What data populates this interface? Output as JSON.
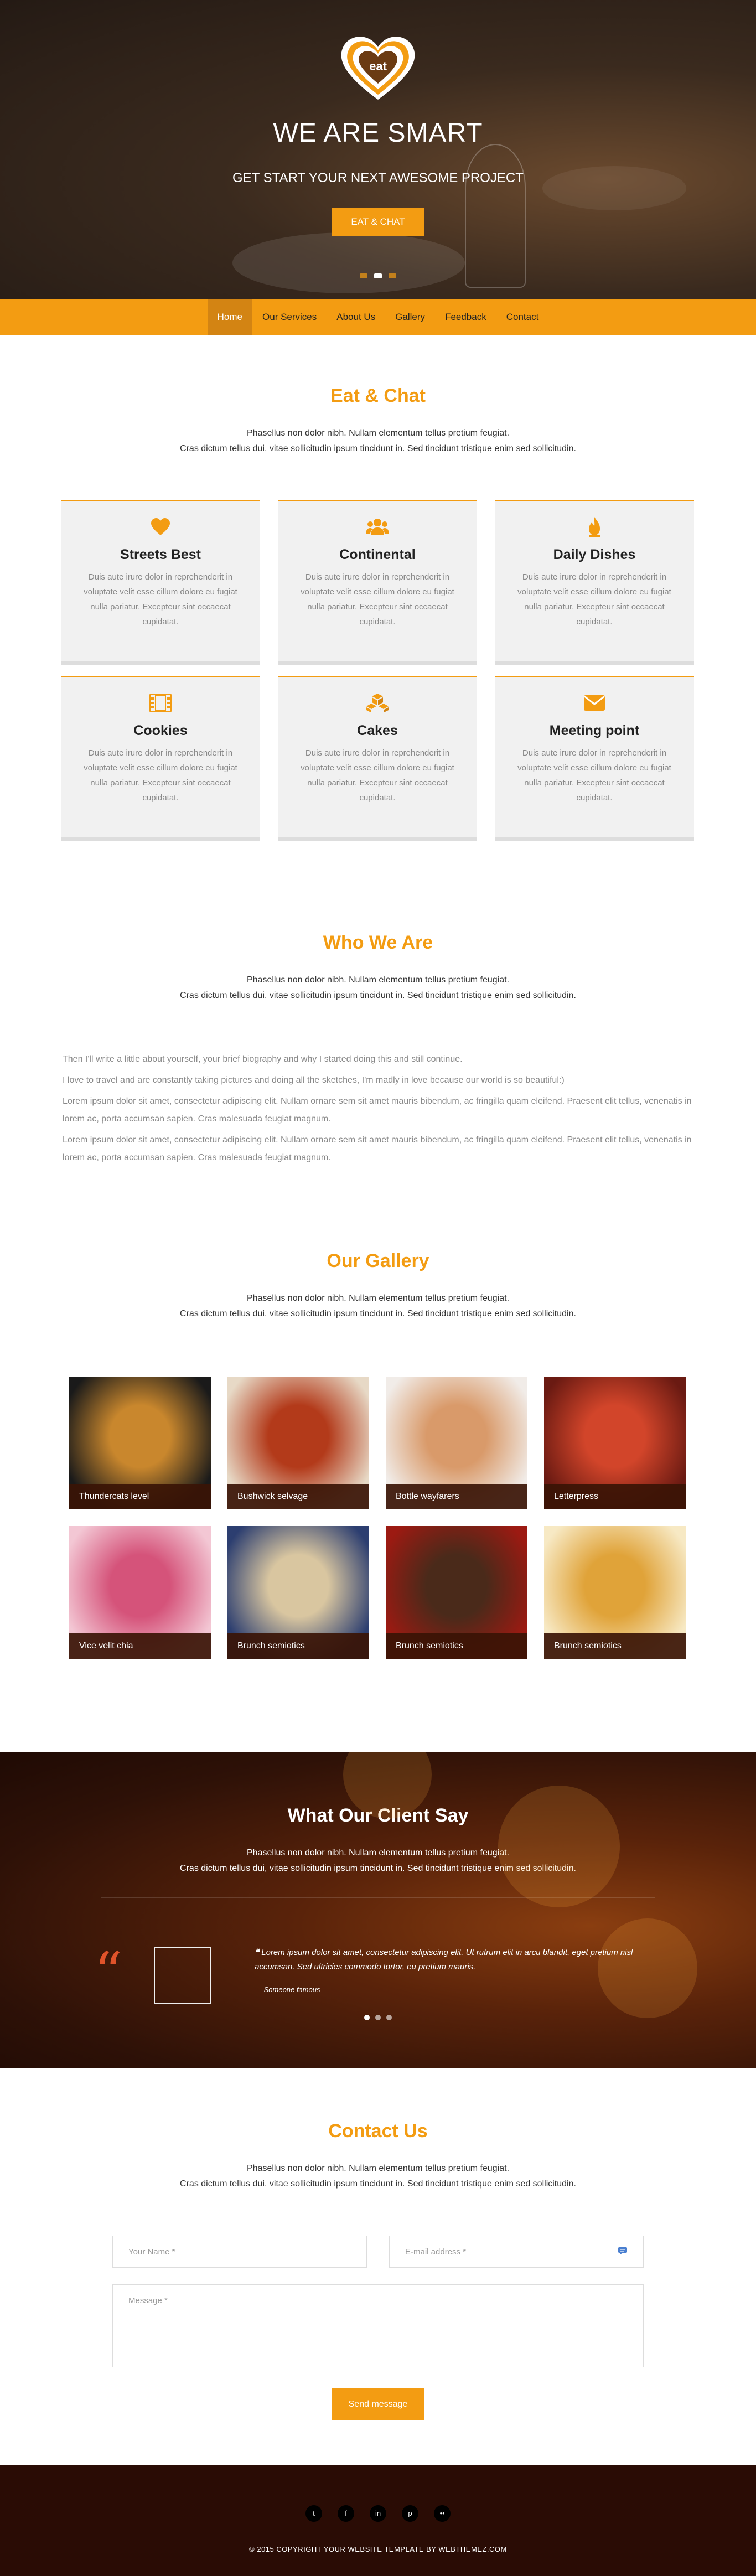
{
  "hero": {
    "logo_text": "eat",
    "title": "WE ARE SMART",
    "subtitle": "GET START YOUR NEXT AWESOME PROJECT",
    "cta": "EAT & CHAT"
  },
  "nav": {
    "items": [
      "Home",
      "Our Services",
      "About Us",
      "Gallery",
      "Feedback",
      "Contact"
    ],
    "active": "Home"
  },
  "intro_line1": "Phasellus non dolor nibh. Nullam elementum tellus pretium feugiat.",
  "intro_line2": "Cras dictum tellus dui, vitae sollicitudin ipsum tincidunt in. Sed tincidunt tristique enim sed sollicitudin.",
  "features": {
    "title": "Eat & Chat",
    "cards": [
      {
        "icon": "heart-icon",
        "title": "Streets Best",
        "text": "Duis aute irure dolor in reprehenderit in voluptate velit esse cillum dolore eu fugiat nulla pariatur. Excepteur sint occaecat cupidatat."
      },
      {
        "icon": "users-icon",
        "title": "Continental",
        "text": "Duis aute irure dolor in reprehenderit in voluptate velit esse cillum dolore eu fugiat nulla pariatur. Excepteur sint occaecat cupidatat."
      },
      {
        "icon": "fire-icon",
        "title": "Daily Dishes",
        "text": "Duis aute irure dolor in reprehenderit in voluptate velit esse cillum dolore eu fugiat nulla pariatur. Excepteur sint occaecat cupidatat."
      },
      {
        "icon": "film-icon",
        "title": "Cookies",
        "text": "Duis aute irure dolor in reprehenderit in voluptate velit esse cillum dolore eu fugiat nulla pariatur. Excepteur sint occaecat cupidatat."
      },
      {
        "icon": "cubes-icon",
        "title": "Cakes",
        "text": "Duis aute irure dolor in reprehenderit in voluptate velit esse cillum dolore eu fugiat nulla pariatur. Excepteur sint occaecat cupidatat."
      },
      {
        "icon": "envelope-icon",
        "title": "Meeting point",
        "text": "Duis aute irure dolor in reprehenderit in voluptate velit esse cillum dolore eu fugiat nulla pariatur. Excepteur sint occaecat cupidatat."
      }
    ]
  },
  "about": {
    "title": "Who We Are",
    "paragraphs": [
      "Then I'll write a little about yourself, your brief biography and why I started doing this and still continue.",
      "I love to travel and are constantly taking pictures and doing all the sketches, I'm madly in love because our world is so beautiful:)",
      "Lorem ipsum dolor sit amet, consectetur adipiscing elit. Nullam ornare sem sit amet mauris bibendum, ac fringilla quam eleifend. Praesent elit tellus, venenatis in lorem ac, porta accumsan sapien. Cras malesuada feugiat magnum.",
      "Lorem ipsum dolor sit amet, consectetur adipiscing elit. Nullam ornare sem sit amet mauris bibendum, ac fringilla quam eleifend. Praesent elit tellus, venenatis in lorem ac, porta accumsan sapien. Cras malesuada feugiat magnum."
    ]
  },
  "gallery": {
    "title": "Our Gallery",
    "items": [
      {
        "caption": "Thundercats level",
        "colors": [
          "#1a1a1a",
          "#c9872d"
        ]
      },
      {
        "caption": "Bushwick selvage",
        "colors": [
          "#e7d9c6",
          "#b33a1a"
        ]
      },
      {
        "caption": "Bottle wayfarers",
        "colors": [
          "#f1ece8",
          "#d99a6a"
        ]
      },
      {
        "caption": "Letterpress",
        "colors": [
          "#6a1a12",
          "#d2452a"
        ]
      },
      {
        "caption": "Vice velit chia",
        "colors": [
          "#f3c7d4",
          "#d5537a"
        ]
      },
      {
        "caption": "Brunch semiotics",
        "colors": [
          "#2c3e70",
          "#d9c6a0"
        ]
      },
      {
        "caption": "Brunch semiotics",
        "colors": [
          "#9c1a12",
          "#4a2a1a"
        ]
      },
      {
        "caption": "Brunch semiotics",
        "colors": [
          "#f7e9c4",
          "#e0a339"
        ]
      }
    ]
  },
  "testimonial": {
    "title": "What Our Client Say",
    "quote": "Lorem ipsum dolor sit amet, consectetur adipiscing elit. Ut rutrum elit in arcu blandit, eget pretium nisl accumsan. Sed ultricies commodo tortor, eu pretium mauris.",
    "author": "— Someone famous"
  },
  "contact": {
    "title": "Contact Us",
    "name_placeholder": "Your Name *",
    "email_placeholder": "E-mail address *",
    "message_placeholder": "Message *",
    "send": "Send message"
  },
  "footer": {
    "socials": [
      "twitter-icon",
      "facebook-icon",
      "linkedin-icon",
      "pinterest-icon",
      "flickr-icon"
    ],
    "copyright": "© 2015 COPYRIGHT YOUR WEBSITE TEMPLATE BY WEBTHEMEZ.COM"
  },
  "colors": {
    "accent": "#f39c12",
    "dark": "#2a0c05"
  }
}
